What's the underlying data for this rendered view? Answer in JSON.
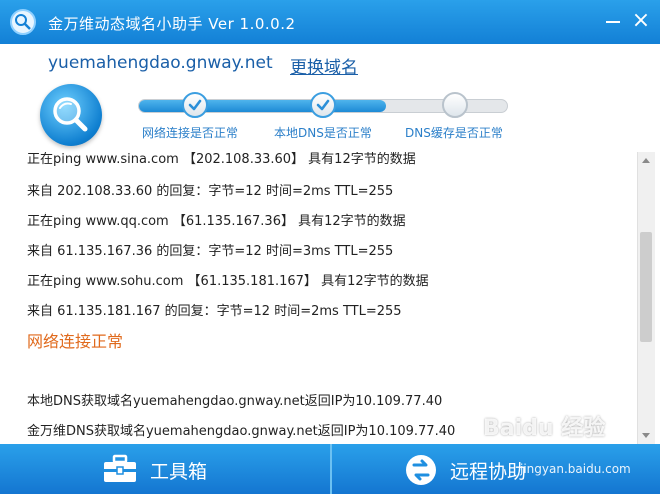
{
  "window": {
    "title": "金万维动态域名小助手 Ver 1.0.0.2"
  },
  "header": {
    "domain": "yuemahengdao.gnway.net",
    "change_domain_link": "更换域名"
  },
  "steps": {
    "progress_percent": 67,
    "items": [
      {
        "label": "网络连接是否正常",
        "status": "done"
      },
      {
        "label": "本地DNS是否正常",
        "status": "done"
      },
      {
        "label": "DNS缓存是否正常",
        "status": "pending"
      }
    ]
  },
  "log": {
    "lines": [
      {
        "text": "正在ping www.sina.com 【202.108.33.60】 具有12字节的数据",
        "type": "normal"
      },
      {
        "text": "来自 202.108.33.60 的回复：字节=12 时间=2ms TTL=255",
        "type": "normal"
      },
      {
        "text": "正在ping www.qq.com 【61.135.167.36】 具有12字节的数据",
        "type": "normal"
      },
      {
        "text": "来自 61.135.167.36 的回复：字节=12 时间=3ms TTL=255",
        "type": "normal"
      },
      {
        "text": "正在ping www.sohu.com 【61.135.181.167】 具有12字节的数据",
        "type": "normal"
      },
      {
        "text": "来自 61.135.181.167 的回复：字节=12 时间=2ms TTL=255",
        "type": "normal"
      },
      {
        "text": "网络连接正常",
        "type": "status"
      },
      {
        "text": "本地DNS获取域名yuemahengdao.gnway.net返回IP为10.109.77.40",
        "type": "normal"
      },
      {
        "text": "金万维DNS获取域名yuemahengdao.gnway.net返回IP为10.109.77.40",
        "type": "normal"
      }
    ]
  },
  "footer": {
    "tools_label": "工具箱",
    "remote_label": "远程协助"
  },
  "watermark": {
    "brand": "Baidu 经验",
    "url": "jingyan.baidu.com"
  },
  "colors": {
    "title_bar": "#1f8fe0",
    "link": "#1a5fa8",
    "status_ok": "#e06a1d",
    "step_label": "#2b7fc9"
  }
}
